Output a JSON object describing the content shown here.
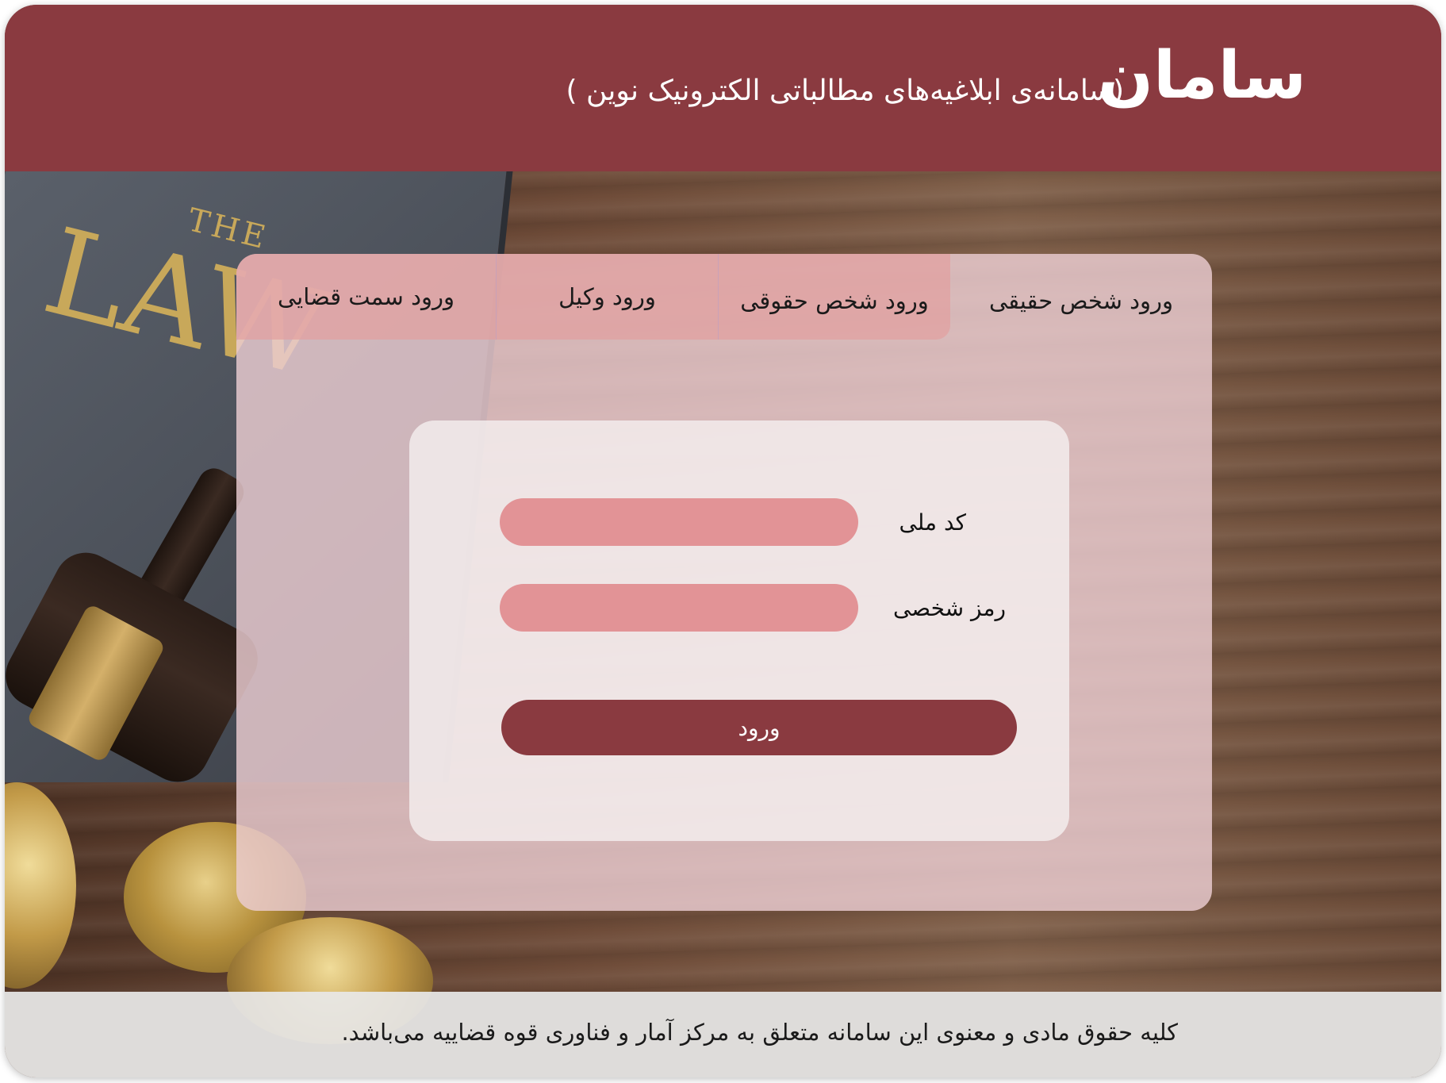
{
  "header": {
    "brand": "سامان",
    "subtitle": "(سامانه‌ی ابلاغیه‌های مطالباتی الکترونیک نوین )"
  },
  "background": {
    "book_title_small": "THE",
    "book_title_large": "LAW"
  },
  "tabs": [
    {
      "label": "ورود شخص حقیقی",
      "active": true
    },
    {
      "label": "ورود شخص حقوقی",
      "active": false
    },
    {
      "label": "ورود وکیل",
      "active": false
    },
    {
      "label": "ورود سمت قضایی",
      "active": false
    }
  ],
  "form": {
    "national_code_label": "کد ملی",
    "national_code_value": "",
    "password_label": "رمز شخصی",
    "password_value": "",
    "submit_label": "ورود"
  },
  "footer": {
    "copyright": "کلیه حقوق مادی و معنوی این سامانه متعلق به مرکز آمار و فناوری قوه قضاییه می‌باشد."
  },
  "colors": {
    "brand": "#8a3a40",
    "input_fill": "#e29396",
    "tab_inactive": "#e2a0a0"
  }
}
